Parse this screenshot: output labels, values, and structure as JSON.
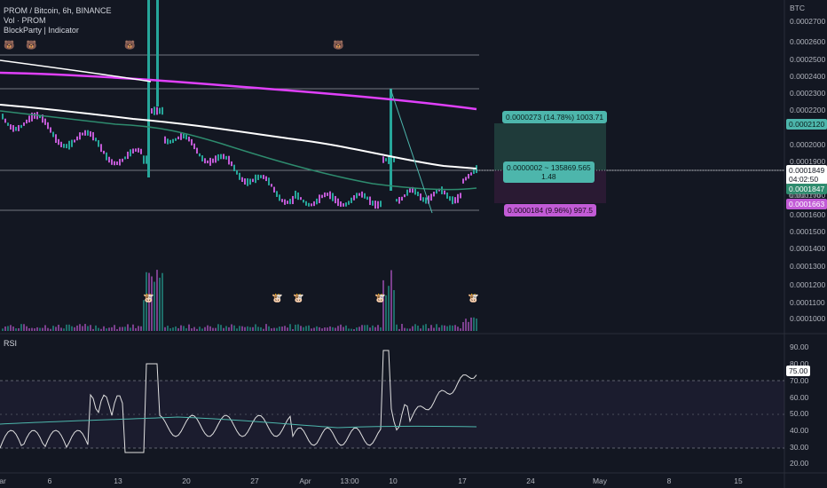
{
  "legend": {
    "symbol": "PROM / Bitcoin, 6h, BINANCE",
    "volume": "Vol · PROM",
    "indicator": "BlockParty | Indicator",
    "rsi": "RSI"
  },
  "price_axis": {
    "currency": "BTC",
    "ticks": [
      "0.0002700",
      "0.0002600",
      "0.0002500",
      "0.0002400",
      "0.0002300",
      "0.0002200",
      "0.0002000",
      "0.0001900",
      "0.0001700",
      "0.0001600",
      "0.0001500",
      "0.0001400",
      "0.0001300",
      "0.0001200",
      "0.0001100",
      "0.0001000"
    ],
    "last_price": "0.0001849",
    "countdown": "04:02:50",
    "tag_target": "0.0002120",
    "tag_ma": "0.0001847",
    "tag_stop_label": "0.0001700",
    "tag_stop": "0.0001663"
  },
  "rsi_axis": {
    "ticks": [
      "90.00",
      "80.00",
      "70.00",
      "60.00",
      "50.00",
      "40.00",
      "30.00",
      "20.00"
    ],
    "last_value": "75.00"
  },
  "date_axis": {
    "ticks": [
      "ar",
      "6",
      "13",
      "20",
      "27",
      "Apr",
      "13:00",
      "10",
      "17",
      "24",
      "May",
      "8",
      "15"
    ]
  },
  "position": {
    "target_label": "0.0000273 (14.78%) 1003.71",
    "entry_line1": "0.0000002 ~ 135869.565",
    "entry_line2": "1.48",
    "stop_label": "0.0000184 (9.96%) 997.5"
  },
  "colors": {
    "background": "#131722",
    "candle_up": "#26a69a",
    "candle_down": "#c25bd6",
    "ma_white": "#ffffff",
    "ma_magenta": "#e040fb",
    "ma_teal": "#2e8b6e",
    "target_zone": "#1f3b3a",
    "stop_zone": "#2a1a33",
    "rsi_line": "#e0e0e0",
    "rsi_ma": "#4db6ac"
  },
  "icons": {
    "top_markers": "bear-face-icon",
    "volume_markers": "cow-icon"
  }
}
